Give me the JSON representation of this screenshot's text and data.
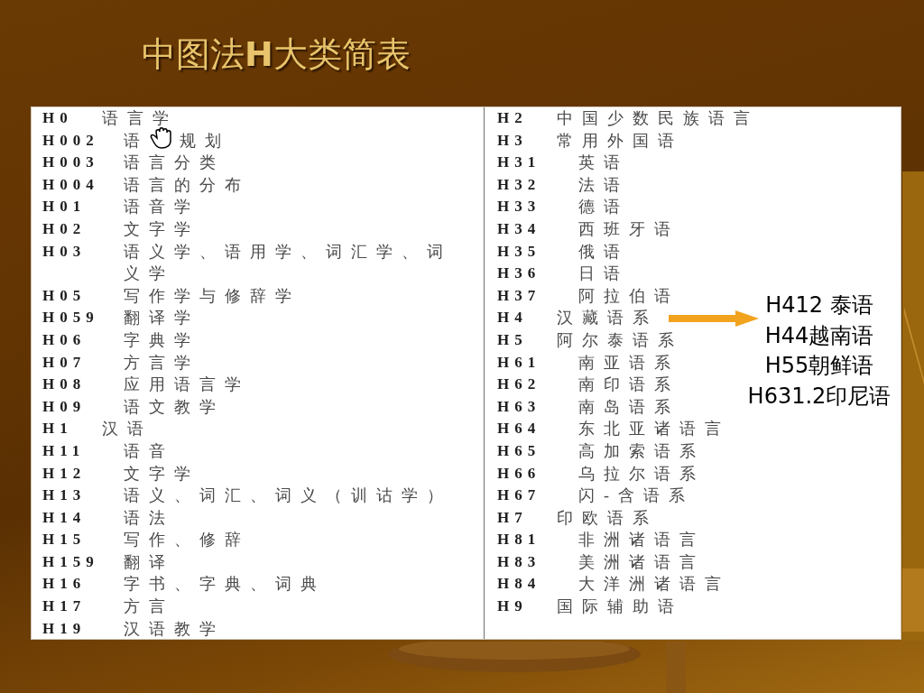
{
  "slide": {
    "title": "中图法**H**大类简表"
  },
  "table": {
    "columns": [
      {
        "entries": [
          {
            "code": "H0",
            "text": "语言学",
            "children": [
              {
                "code": "H002",
                "text": "语",
                "text_after_cursor": "规划"
              },
              {
                "code": "H003",
                "text": "语言分类"
              },
              {
                "code": "H004",
                "text": "语言的分布"
              },
              {
                "code": "H01",
                "text": "语音学"
              },
              {
                "code": "H02",
                "text": "文字学"
              },
              {
                "code": "H03",
                "text": "语义学、语用学、词汇学、词义学"
              },
              {
                "code": "H05",
                "text": "写作学与修辞学"
              },
              {
                "code": "H059",
                "text": "翻译学"
              },
              {
                "code": "H06",
                "text": "字典学"
              },
              {
                "code": "H07",
                "text": "方言学"
              },
              {
                "code": "H08",
                "text": "应用语言学"
              },
              {
                "code": "H09",
                "text": "语文教学"
              }
            ]
          },
          {
            "code": "H1",
            "text": "汉语",
            "children": [
              {
                "code": "H11",
                "text": "语音"
              },
              {
                "code": "H12",
                "text": "文字学"
              },
              {
                "code": "H13",
                "text": "语义、词汇、词义（训诂学）"
              },
              {
                "code": "H14",
                "text": "语法"
              },
              {
                "code": "H15",
                "text": "写作、修辞"
              },
              {
                "code": "H159",
                "text": "翻译"
              },
              {
                "code": "H16",
                "text": "字书、字典、词典"
              },
              {
                "code": "H17",
                "text": "方言"
              },
              {
                "code": "H19",
                "text": "汉语教学"
              }
            ]
          }
        ]
      },
      {
        "entries": [
          {
            "code": "H2",
            "text": "中国少数民族语言"
          },
          {
            "code": "H3",
            "text": "常用外国语",
            "children": [
              {
                "code": "H31",
                "text": "英语"
              },
              {
                "code": "H32",
                "text": "法语"
              },
              {
                "code": "H33",
                "text": "德语"
              },
              {
                "code": "H34",
                "text": "西班牙语"
              },
              {
                "code": "H35",
                "text": "俄语"
              },
              {
                "code": "H36",
                "text": "日语"
              },
              {
                "code": "H37",
                "text": "阿拉伯语"
              }
            ]
          },
          {
            "code": "H4",
            "text": "汉藏语系"
          },
          {
            "code": "H5",
            "text": "阿尔泰语系",
            "children": [
              {
                "code": "H61",
                "text": "南亚语系"
              },
              {
                "code": "H62",
                "text": "南印语系"
              },
              {
                "code": "H63",
                "text": "南岛语系"
              },
              {
                "code": "H64",
                "text": "东北亚诸语言"
              },
              {
                "code": "H65",
                "text": "高加索语系"
              },
              {
                "code": "H66",
                "text": "乌拉尔语系"
              },
              {
                "code": "H67",
                "text": "闪-含语系"
              }
            ]
          },
          {
            "code": "H7",
            "text": "印欧语系",
            "children": [
              {
                "code": "H81",
                "text": "非洲诸语言"
              },
              {
                "code": "H83",
                "text": "美洲诸语言"
              },
              {
                "code": "H84",
                "text": "大洋洲诸语言"
              }
            ]
          },
          {
            "code": "H9",
            "text": "国际辅助语"
          }
        ]
      }
    ]
  },
  "callout": {
    "lines": [
      "H412 泰语",
      "H44越南语",
      "H55朝鲜语",
      "H631.2印尼语"
    ]
  }
}
